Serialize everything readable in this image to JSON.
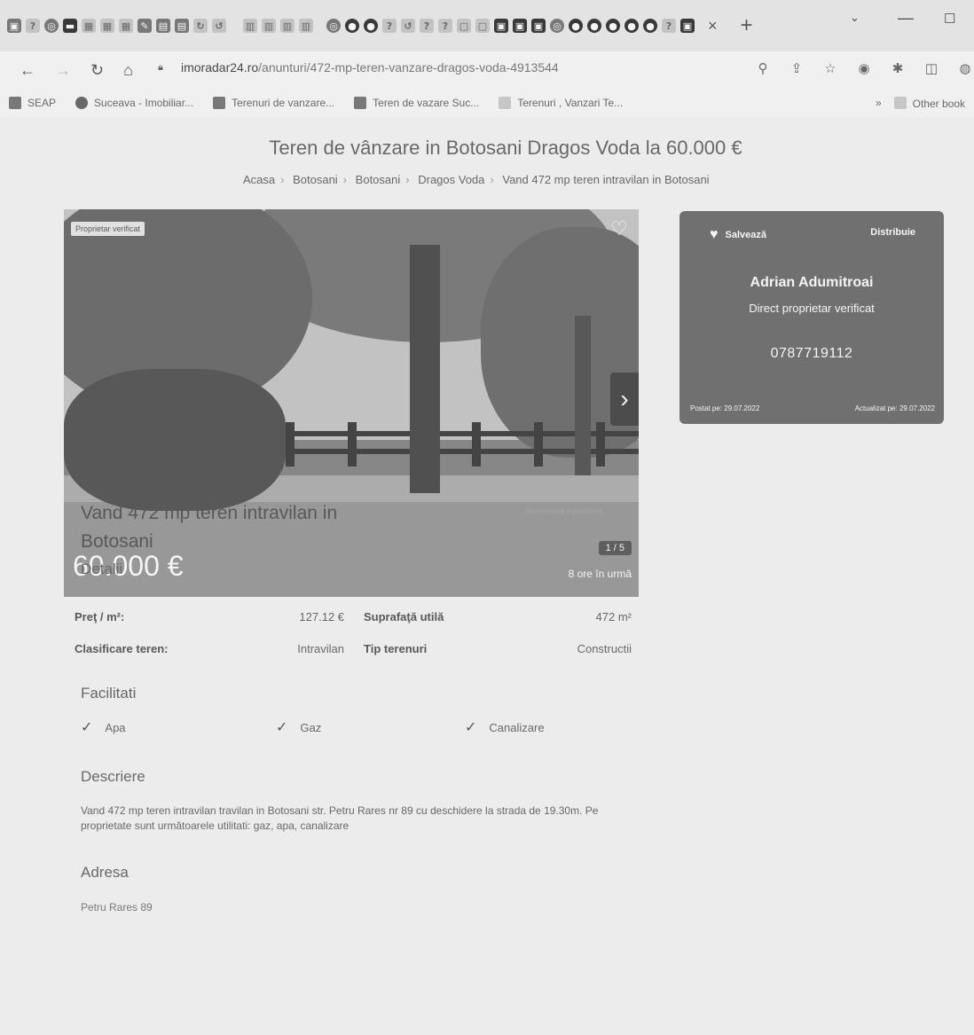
{
  "browser": {
    "tab_close": "×",
    "tab_new": "+",
    "url_host": "imoradar24.ro",
    "url_path": "/anunturi/472-mp-teren-vanzare-dragos-voda-4913544",
    "bookmarks": [
      "SEAP",
      "Suceava - Imobiliar...",
      "Terenuri de vanzare...",
      "Teren de vazare Suc...",
      "Terenuri , Vanzari Te..."
    ],
    "bookmarks_more": "»",
    "other_bookmarks": "Other book"
  },
  "page": {
    "title": "Teren de vânzare in Botosani Dragos Voda la 60.000 €",
    "breadcrumb": [
      "Acasa",
      "Botosani",
      "Botosani",
      "Dragos Voda",
      "Vand 472 mp teren intravilan in Botosani"
    ]
  },
  "gallery": {
    "badge": "Proprietar verificat",
    "price": "60.000 €",
    "counter": "1 / 5",
    "posted_ago": "8 ore în urmă"
  },
  "card": {
    "save_label": "Salvează",
    "share_label": "Distribuie",
    "name": "Adrian Adumitroai",
    "subtitle": "Direct proprietar verificat",
    "phone": "0787719112",
    "posted": "Postat pe: 29.07.2022",
    "updated": "Actualizat pe: 29.07.2022"
  },
  "listing": {
    "title": "Vand 472 mp teren intravilan in Botosani",
    "report": "Semnalează o problemă",
    "details_heading": "Detalii",
    "details": [
      {
        "label": "Preţ / m²:",
        "value": "127.12 €"
      },
      {
        "label": "Suprafaţă utilă",
        "value": "472 m²"
      },
      {
        "label": "Clasificare teren:",
        "value": "Intravilan"
      },
      {
        "label": "Tip terenuri",
        "value": "Constructii"
      }
    ],
    "facilities_heading": "Facilitati",
    "facilities": [
      "Apa",
      "Gaz",
      "Canalizare"
    ],
    "description_heading": "Descriere",
    "description": "Vand 472 mp teren intravilan travilan in Botosani str. Petru Rares nr 89 cu deschidere la strada de 19.30m. Pe proprietate sunt următoarele utilitati: gaz, apa, canalizare",
    "address_heading": "Adresa",
    "address": "Petru Rares 89"
  }
}
